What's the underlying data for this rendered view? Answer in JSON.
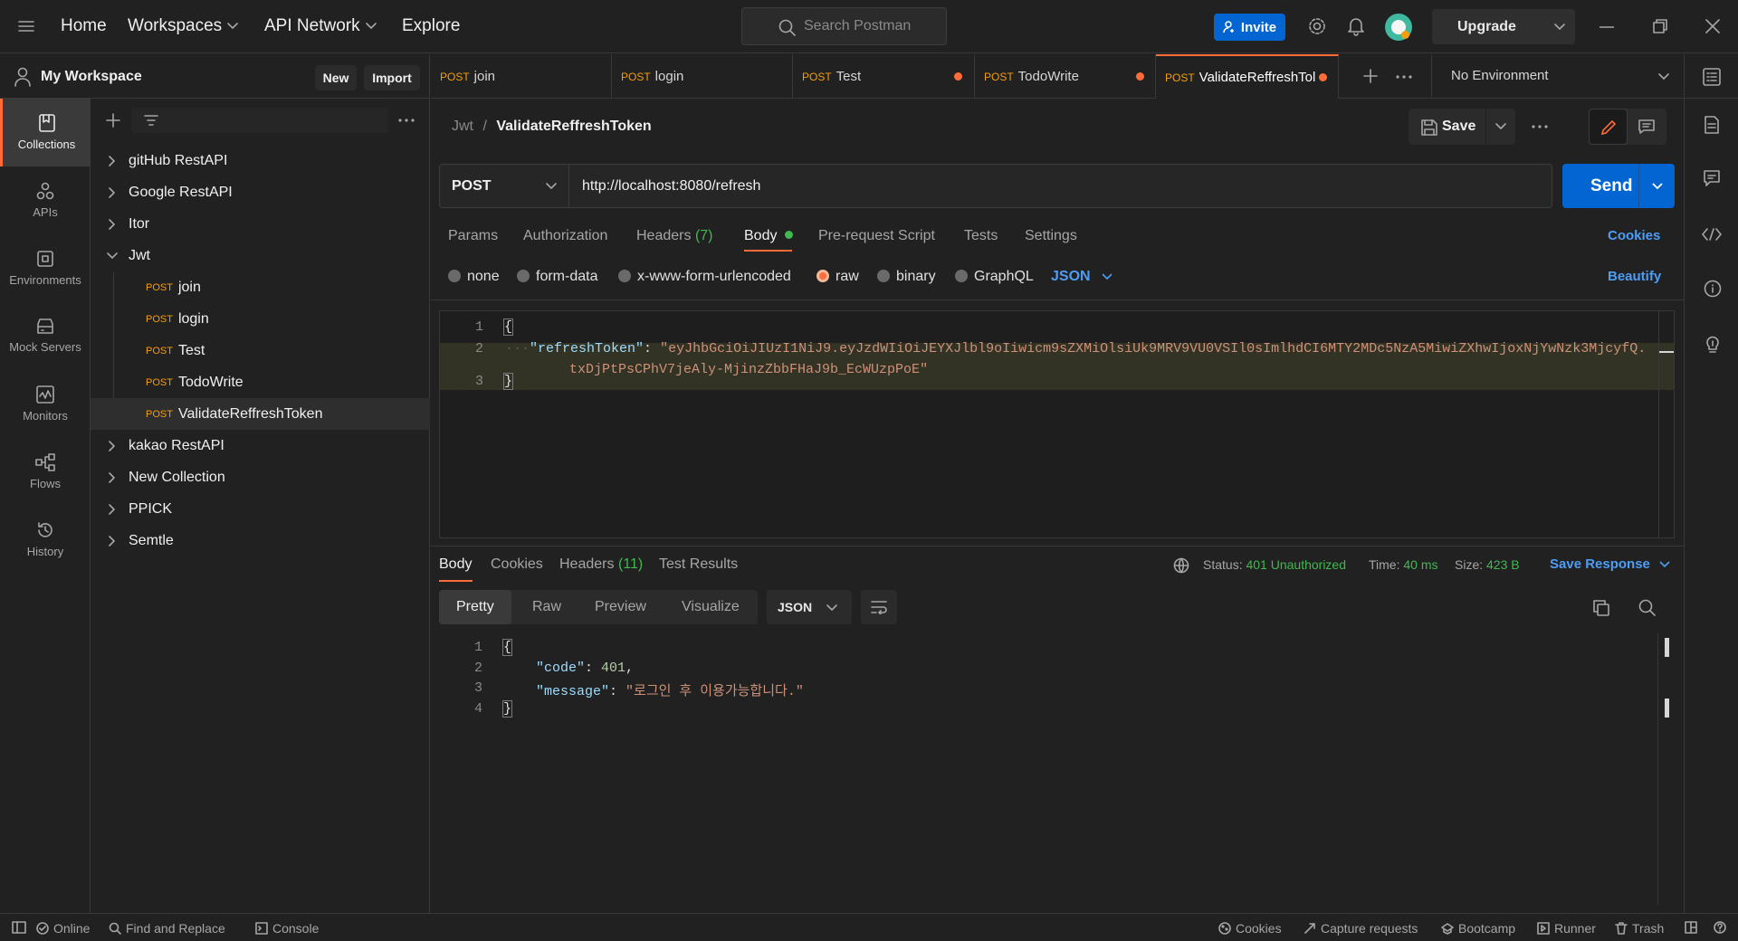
{
  "topbar": {
    "home": "Home",
    "workspaces": "Workspaces",
    "api_network": "API Network",
    "explore": "Explore",
    "search_placeholder": "Search Postman",
    "invite": "Invite",
    "upgrade": "Upgrade"
  },
  "workspace": {
    "name": "My Workspace",
    "new": "New",
    "import": "Import"
  },
  "rail": [
    {
      "label": "Collections",
      "icon": "collections-icon"
    },
    {
      "label": "APIs",
      "icon": "apis-icon"
    },
    {
      "label": "Environments",
      "icon": "environments-icon"
    },
    {
      "label": "Mock Servers",
      "icon": "mock-servers-icon"
    },
    {
      "label": "Monitors",
      "icon": "monitors-icon"
    },
    {
      "label": "Flows",
      "icon": "flows-icon"
    },
    {
      "label": "History",
      "icon": "history-icon"
    }
  ],
  "tree": {
    "collections": [
      "gitHub RestAPI",
      "Google RestAPI",
      "Itor",
      "Jwt",
      "kakao RestAPI",
      "New Collection",
      "PPICK",
      "Semtle"
    ],
    "jwt_requests": [
      {
        "method": "POST",
        "name": "join"
      },
      {
        "method": "POST",
        "name": "login"
      },
      {
        "method": "POST",
        "name": "Test"
      },
      {
        "method": "POST",
        "name": "TodoWrite"
      },
      {
        "method": "POST",
        "name": "ValidateReffreshToken"
      }
    ]
  },
  "tabs": [
    {
      "method": "POST",
      "name": "join",
      "unsaved": false
    },
    {
      "method": "POST",
      "name": "login",
      "unsaved": false
    },
    {
      "method": "POST",
      "name": "Test",
      "unsaved": true
    },
    {
      "method": "POST",
      "name": "TodoWrite",
      "unsaved": true
    },
    {
      "method": "POST",
      "name": "ValidateReffreshTol",
      "unsaved": true
    }
  ],
  "environment": "No Environment",
  "request": {
    "breadcrumb_parent": "Jwt",
    "breadcrumb_sep": "/",
    "breadcrumb_name": "ValidateReffreshToken",
    "save": "Save",
    "method": "POST",
    "url": "http://localhost:8080/refresh",
    "send": "Send",
    "tabs": {
      "params": "Params",
      "authorization": "Authorization",
      "headers": "Headers",
      "headers_count": "(7)",
      "body": "Body",
      "prerequest": "Pre-request Script",
      "tests": "Tests",
      "settings": "Settings"
    },
    "cookies": "Cookies",
    "body_types": {
      "none": "none",
      "form_data": "form-data",
      "urlencoded": "x-www-form-urlencoded",
      "raw": "raw",
      "binary": "binary",
      "graphql": "GraphQL"
    },
    "body_format": "JSON",
    "beautify": "Beautify",
    "body_lines": {
      "n1": "1",
      "n2": "2",
      "n3": "3",
      "open": "{",
      "key": "\"refreshToken\"",
      "colon": ": ",
      "value1": "\"eyJhbGciOiJIUzI1NiJ9.eyJzdWIiOiJEYXJlbl9oIiwicm9sZXMiOlsiUk9MRV9VU0VSIl0sImlhdCI6MTY2MDc5NzA5MiwiZXhwIjoxNjYwNzk3MjcyfQ.",
      "value2": "txDjPtPsCPhV7jeAly-MjinzZbbFHaJ9b_EcWUzpPoE\"",
      "close": "}"
    }
  },
  "response": {
    "tabs": {
      "body": "Body",
      "cookies": "Cookies",
      "headers": "Headers",
      "headers_count": "(11)",
      "test_results": "Test Results"
    },
    "status_label": "Status:",
    "status": "401 Unauthorized",
    "time_label": "Time:",
    "time": "40 ms",
    "size_label": "Size:",
    "size": "423 B",
    "save_response": "Save Response",
    "views": {
      "pretty": "Pretty",
      "raw": "Raw",
      "preview": "Preview",
      "visualize": "Visualize"
    },
    "format": "JSON",
    "lines": {
      "n1": "1",
      "n2": "2",
      "n3": "3",
      "n4": "4",
      "open": "{",
      "code_key": "\"code\"",
      "code_val": "401",
      "comma": ",",
      "msg_key": "\"message\"",
      "msg_val": "\"로그인 후 이용가능합니다.\"",
      "colon": ": ",
      "close": "}"
    }
  },
  "statusbar": {
    "online": "Online",
    "find_replace": "Find and Replace",
    "console": "Console",
    "cookies": "Cookies",
    "capture": "Capture requests",
    "bootcamp": "Bootcamp",
    "runner": "Runner",
    "trash": "Trash"
  },
  "colors": {
    "accent": "#ff6c37",
    "primary": "#0265d2",
    "status_ok": "#3fb950",
    "method_post": "#f59e0b"
  }
}
